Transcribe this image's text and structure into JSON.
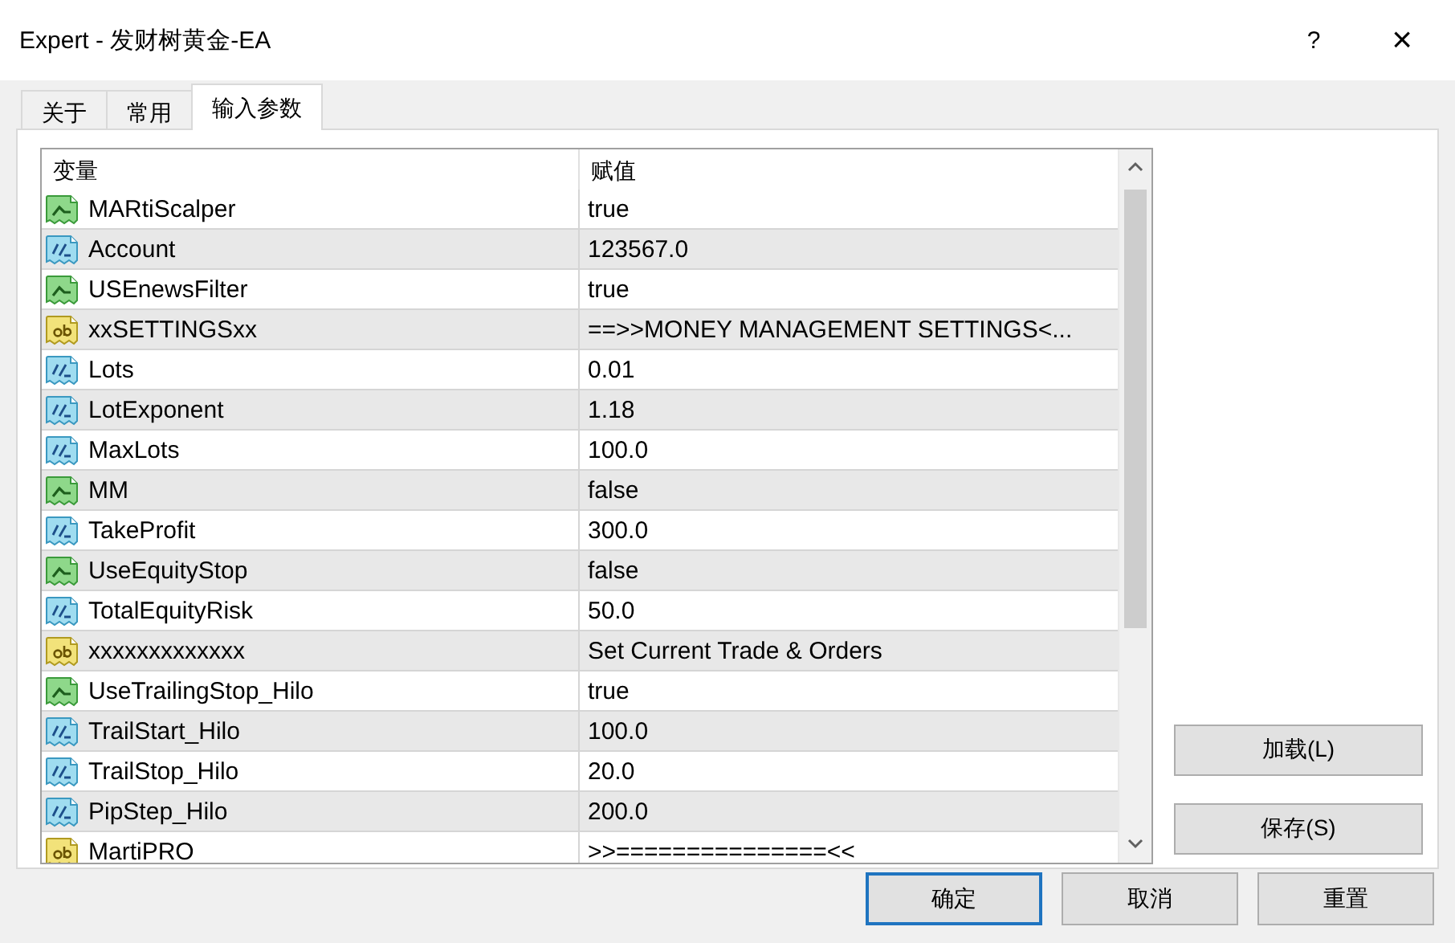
{
  "window": {
    "title": "Expert - 发财树黄金-EA",
    "help": "?",
    "close": "×"
  },
  "tabs": [
    {
      "label": "关于",
      "selected": false
    },
    {
      "label": "常用",
      "selected": false
    },
    {
      "label": "输入参数",
      "selected": true
    }
  ],
  "table": {
    "columns": [
      "变量",
      "赋值"
    ],
    "rows": [
      {
        "kind": "bool",
        "name": "MARtiScalper",
        "value": "true"
      },
      {
        "kind": "number",
        "name": "Account",
        "value": "123567.0"
      },
      {
        "kind": "bool",
        "name": "USEnewsFilter",
        "value": "true"
      },
      {
        "kind": "string",
        "name": "xxSETTINGSxx",
        "value": "==>>MONEY MANAGEMENT SETTINGS<..."
      },
      {
        "kind": "number",
        "name": "Lots",
        "value": "0.01"
      },
      {
        "kind": "number",
        "name": "LotExponent",
        "value": "1.18"
      },
      {
        "kind": "number",
        "name": "MaxLots",
        "value": "100.0"
      },
      {
        "kind": "bool",
        "name": "MM",
        "value": "false"
      },
      {
        "kind": "number",
        "name": "TakeProfit",
        "value": "300.0"
      },
      {
        "kind": "bool",
        "name": "UseEquityStop",
        "value": "false"
      },
      {
        "kind": "number",
        "name": "TotalEquityRisk",
        "value": "50.0"
      },
      {
        "kind": "string",
        "name": "xxxxxxxxxxxxx",
        "value": "Set Current Trade & Orders"
      },
      {
        "kind": "bool",
        "name": "UseTrailingStop_Hilo",
        "value": "true"
      },
      {
        "kind": "number",
        "name": "TrailStart_Hilo",
        "value": "100.0"
      },
      {
        "kind": "number",
        "name": "TrailStop_Hilo",
        "value": "20.0"
      },
      {
        "kind": "number",
        "name": "PipStep_Hilo",
        "value": "200.0"
      },
      {
        "kind": "string",
        "name": "MartiPRO",
        "value": ">>===============<<"
      }
    ]
  },
  "side_buttons": [
    {
      "label": "加载(L)"
    },
    {
      "label": "保存(S)"
    }
  ],
  "buttons": [
    {
      "label": "确定",
      "default": true
    },
    {
      "label": "取消",
      "default": false
    },
    {
      "label": "重置",
      "default": false
    }
  ]
}
